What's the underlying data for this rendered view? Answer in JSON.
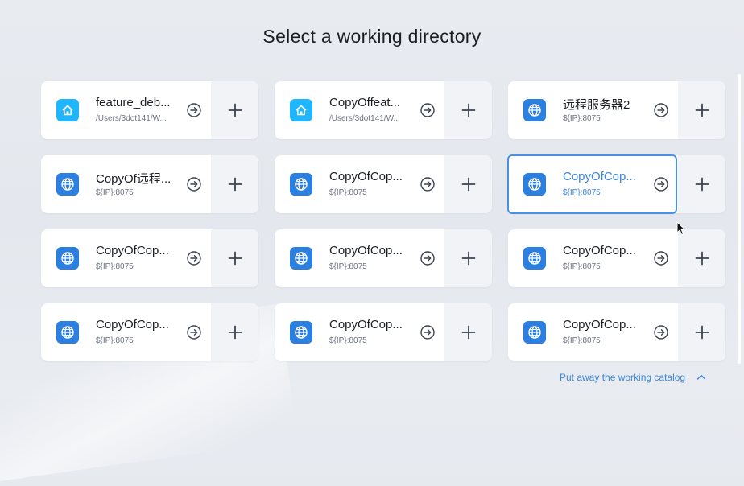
{
  "page": {
    "title": "Select a working directory"
  },
  "colors": {
    "accent": "#3a86d8",
    "home_icon": "#1fb6ff",
    "globe_icon": "#2a7fe0"
  },
  "directories": [
    {
      "name": "feature_deb...",
      "path": "/Users/3dot141/W...",
      "icon": "home-icon",
      "selected": false
    },
    {
      "name": "CopyOffeat...",
      "path": "/Users/3dot141/W...",
      "icon": "home-icon",
      "selected": false
    },
    {
      "name": "远程服务器2",
      "path": "${IP}:8075",
      "icon": "globe-icon",
      "selected": false
    },
    {
      "name": "CopyOf远程...",
      "path": "${IP}:8075",
      "icon": "globe-icon",
      "selected": false
    },
    {
      "name": "CopyOfCop...",
      "path": "${IP}:8075",
      "icon": "globe-icon",
      "selected": false
    },
    {
      "name": "CopyOfCop...",
      "path": "${IP}:8075",
      "icon": "globe-icon",
      "selected": true
    },
    {
      "name": "CopyOfCop...",
      "path": "${IP}:8075",
      "icon": "globe-icon",
      "selected": false
    },
    {
      "name": "CopyOfCop...",
      "path": "${IP}:8075",
      "icon": "globe-icon",
      "selected": false
    },
    {
      "name": "CopyOfCop...",
      "path": "${IP}:8075",
      "icon": "globe-icon",
      "selected": false
    },
    {
      "name": "CopyOfCop...",
      "path": "${IP}:8075",
      "icon": "globe-icon",
      "selected": false
    },
    {
      "name": "CopyOfCop...",
      "path": "${IP}:8075",
      "icon": "globe-icon",
      "selected": false
    },
    {
      "name": "CopyOfCop...",
      "path": "${IP}:8075",
      "icon": "globe-icon",
      "selected": false
    }
  ],
  "footer": {
    "collapse_label": "Put away the working catalog",
    "icon": "chevron-up-icon"
  }
}
